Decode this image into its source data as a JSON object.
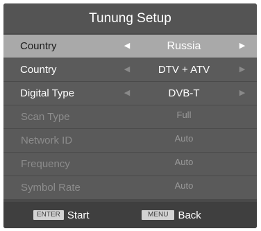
{
  "title": "Tunung Setup",
  "rows": [
    {
      "label": "Country",
      "value": "Russia",
      "left_arrow": "◀",
      "right_arrow": "▶"
    },
    {
      "label": "Country",
      "value": "DTV + ATV",
      "left_arrow": "◀",
      "right_arrow": "▶"
    },
    {
      "label": "Digital Type",
      "value": "DVB-T",
      "left_arrow": "◀",
      "right_arrow": "▶"
    },
    {
      "label": "Scan Type",
      "value": "Full"
    },
    {
      "label": "Network ID",
      "value": "Auto"
    },
    {
      "label": "Frequency",
      "value": "Auto"
    },
    {
      "label": "Symbol Rate",
      "value": "Auto"
    }
  ],
  "footer": {
    "enter_key": "ENTER",
    "enter_label": "Start",
    "menu_key": "MENU",
    "menu_label": "Back"
  },
  "colors": {
    "background": "#4a4a4a",
    "selected_row": "#a9a9a9",
    "row": "#5b5b5b",
    "disabled_text": "#8c8c8c",
    "footer": "#3f3f3f"
  }
}
